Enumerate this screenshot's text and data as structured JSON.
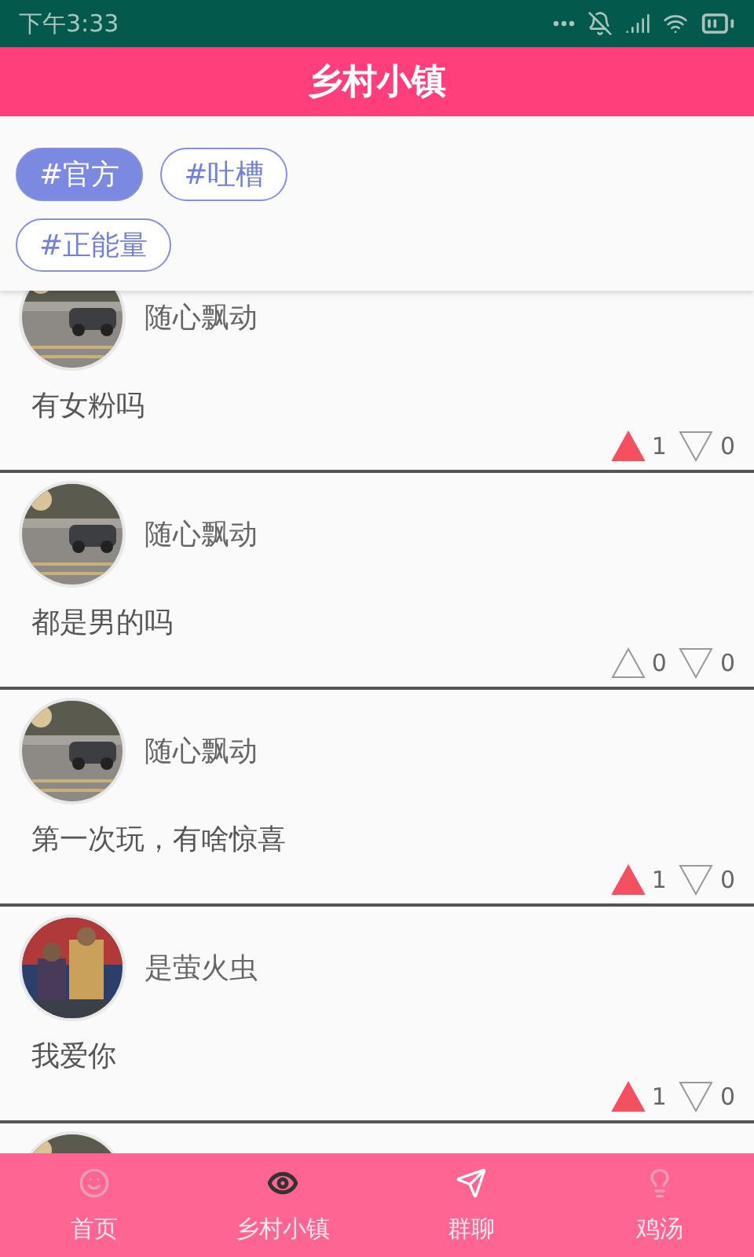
{
  "status_bar": {
    "time": "下午3:33"
  },
  "header": {
    "title": "乡村小镇"
  },
  "tags": [
    {
      "label": "#官方",
      "selected": true
    },
    {
      "label": "#吐槽",
      "selected": false
    },
    {
      "label": "#正能量",
      "selected": false
    }
  ],
  "posts": [
    {
      "author": "随心飘动",
      "text": "有女粉吗",
      "up": {
        "count": "1",
        "selected": true
      },
      "down": {
        "count": "0",
        "selected": false
      }
    },
    {
      "author": "随心飘动",
      "text": "都是男的吗",
      "up": {
        "count": "0",
        "selected": false
      },
      "down": {
        "count": "0",
        "selected": false
      }
    },
    {
      "author": "随心飘动",
      "text": "第一次玩，有啥惊喜",
      "up": {
        "count": "1",
        "selected": true
      },
      "down": {
        "count": "0",
        "selected": false
      }
    },
    {
      "author": "是萤火虫",
      "text": "我爱你",
      "up": {
        "count": "1",
        "selected": true
      },
      "down": {
        "count": "0",
        "selected": false
      }
    }
  ],
  "more_below": true,
  "nav": [
    {
      "kind": "smile",
      "label": "首页",
      "selected": false
    },
    {
      "kind": "eye",
      "label": "乡村小镇",
      "selected": true
    },
    {
      "kind": "plane",
      "label": "群聊",
      "selected": false
    },
    {
      "kind": "bulb",
      "label": "鸡汤",
      "selected": false
    }
  ]
}
